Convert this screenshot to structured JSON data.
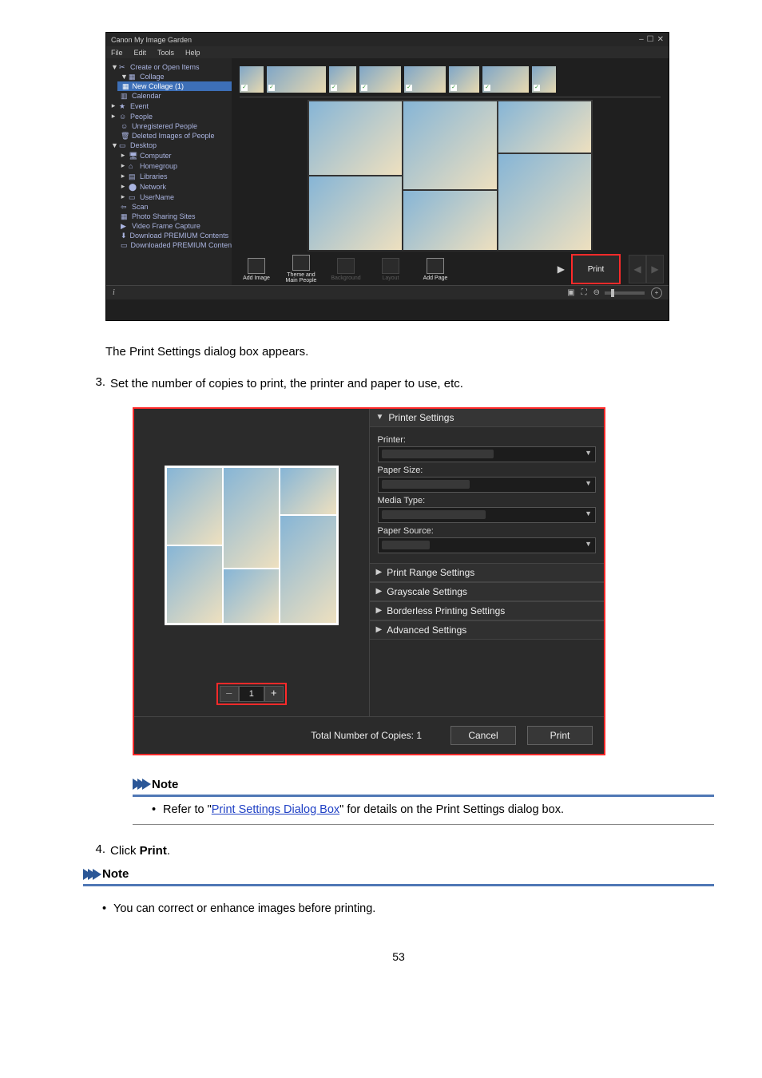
{
  "screenshot1": {
    "title": "Canon My Image Garden",
    "menu": {
      "file": "File",
      "edit": "Edit",
      "tools": "Tools",
      "help": "Help"
    },
    "win": {
      "min": "–",
      "max": "☐",
      "close": "✕"
    },
    "sidebar": {
      "create": "Create or Open Items",
      "collage": "Collage",
      "new_collage": "New Collage (1)",
      "calendar": "Calendar",
      "event": "Event",
      "people": "People",
      "unreg": "Unregistered People",
      "deleted": "Deleted Images of People",
      "desktop": "Desktop",
      "computer": "Computer",
      "homegroup": "Homegroup",
      "libraries": "Libraries",
      "network": "Network",
      "username": "UserName",
      "scan": "Scan",
      "photo_sharing": "Photo Sharing Sites",
      "video_frame": "Video Frame Capture",
      "download_prem": "Download PREMIUM Contents",
      "downloaded_prem": "Downloaded PREMIUM Contents"
    },
    "toolbar": {
      "add_image": "Add Image",
      "theme": "Theme and\nMain People",
      "background": "Background",
      "layout": "Layout",
      "add_page": "Add Page",
      "print": "Print"
    },
    "status_info": "i"
  },
  "textAfterShot1": "The Print Settings dialog box appears.",
  "step3": {
    "num": "3.",
    "text": "Set the number of copies to print, the printer and paper to use, etc."
  },
  "dialog": {
    "printer_settings": "Printer Settings",
    "printer": "Printer:",
    "paper_size": "Paper Size:",
    "media_type": "Media Type:",
    "paper_source": "Paper Source:",
    "print_range": "Print Range Settings",
    "grayscale": "Grayscale Settings",
    "borderless": "Borderless Printing Settings",
    "advanced": "Advanced Settings",
    "copies_value": "1",
    "total_copies": "Total Number of Copies: 1",
    "cancel": "Cancel",
    "print": "Print"
  },
  "note1": {
    "title": "Note",
    "prefix": "Refer to \"",
    "link": "Print Settings Dialog Box",
    "suffix": "\" for details on the Print Settings dialog box."
  },
  "step4": {
    "num": "4.",
    "pre": "Click ",
    "bold": "Print",
    "post": "."
  },
  "note2": {
    "title": "Note",
    "text": "You can correct or enhance images before printing."
  },
  "page_number": "53"
}
